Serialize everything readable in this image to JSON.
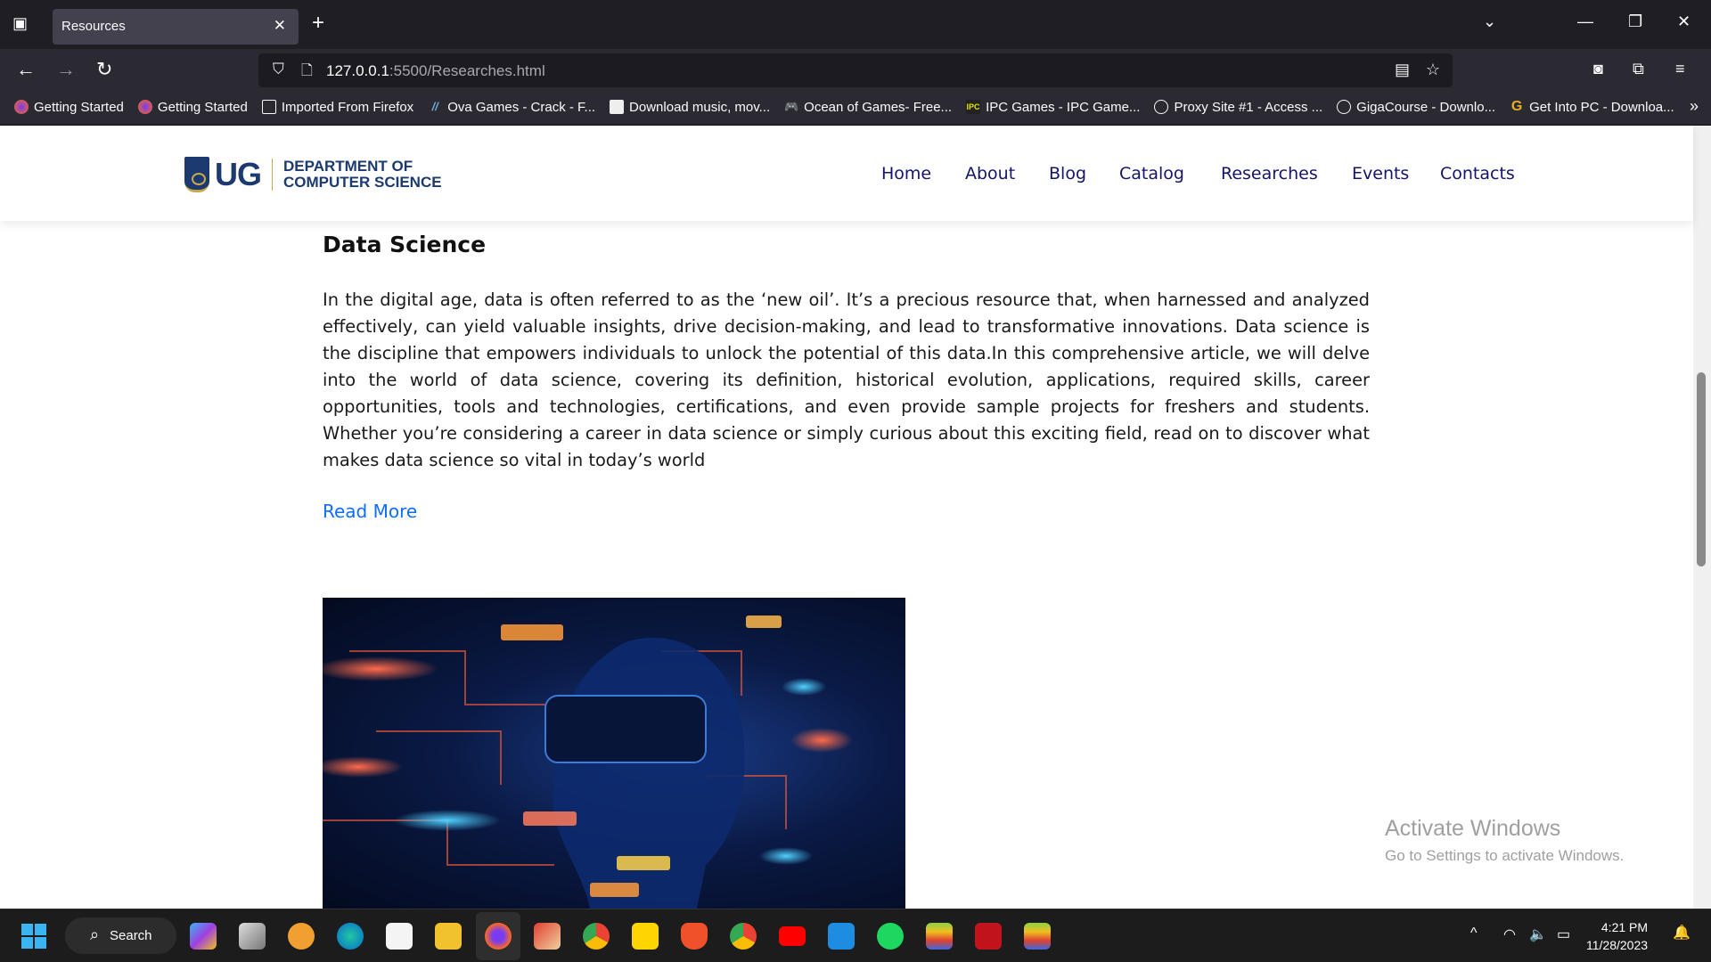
{
  "browser": {
    "tab_title": "Resources",
    "url_host": "127.0.0.1",
    "url_rest": ":5500/Researches.html",
    "bookmarks": [
      {
        "label": "Getting Started",
        "icon": "firefox-icon"
      },
      {
        "label": "Getting Started",
        "icon": "firefox-icon"
      },
      {
        "label": "Imported From Firefox",
        "icon": "folder-icon"
      },
      {
        "label": "Ova Games - Crack - F...",
        "icon": "ova-games-icon"
      },
      {
        "label": "Download music, mov...",
        "icon": "download-site-icon"
      },
      {
        "label": "Ocean of Games- Free...",
        "icon": "gamepad-icon"
      },
      {
        "label": "IPC Games - IPC Game...",
        "icon": "ipc-games-icon"
      },
      {
        "label": "Proxy Site #1 - Access ...",
        "icon": "globe-icon"
      },
      {
        "label": "GigaCourse - Downlo...",
        "icon": "globe-icon"
      },
      {
        "label": "Get Into PC - Downloa...",
        "icon": "g-icon"
      }
    ]
  },
  "site": {
    "logo_text": "UG",
    "dept_line1": "DEPARTMENT OF",
    "dept_line2": "COMPUTER SCIENCE",
    "nav": [
      "Home",
      "About",
      "Blog",
      "Catalog",
      "Researches",
      "Events",
      "Contacts"
    ],
    "nav_color": "#14146b"
  },
  "article": {
    "title": "Data Science",
    "body": "In the digital age, data is often referred to as the ‘new oil’. It’s a precious resource that, when harnessed and analyzed effectively, can yield valuable insights, drive decision-making, and lead to transformative innovations. Data science is the discipline that empowers individuals to unlock the potential of this data.In this comprehensive article, we will delve into the world of data science, covering its definition, historical evolution, applications, required skills, career opportunities, tools and technologies, certifications, and even provide sample projects for freshers and students. Whether you’re considering a career in data science or simply curious about this exciting field, read on to discover what makes data science so vital in today’s world",
    "read_more": "Read More",
    "link_color": "#0d6efd"
  },
  "watermark": {
    "title": "Activate Windows",
    "subtitle": "Go to Settings to activate Windows."
  },
  "taskbar": {
    "search_label": "Search",
    "time": "4:21 PM",
    "date": "11/28/2023"
  }
}
